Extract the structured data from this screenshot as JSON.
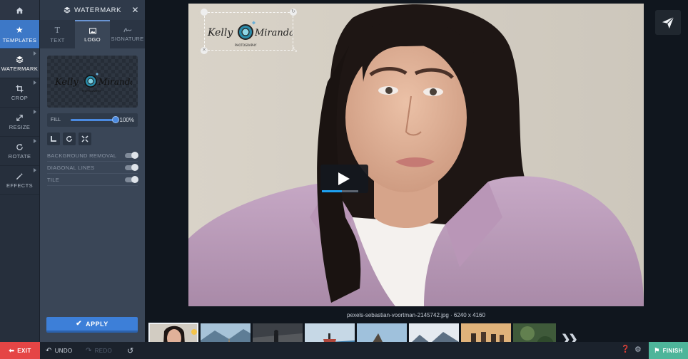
{
  "leftnav": {
    "items": [
      {
        "label": "TEMPLATES",
        "icon": "star-icon"
      },
      {
        "label": "WATERMARK",
        "icon": "layers-icon"
      },
      {
        "label": "CROP",
        "icon": "crop-icon"
      },
      {
        "label": "RESIZE",
        "icon": "resize-icon"
      },
      {
        "label": "ROTATE",
        "icon": "rotate-icon"
      },
      {
        "label": "EFFECTS",
        "icon": "magic-wand-icon"
      }
    ]
  },
  "panel": {
    "title": "WATERMARK",
    "tabs": [
      {
        "label": "TEXT"
      },
      {
        "label": "LOGO"
      },
      {
        "label": "SIGNATURE"
      }
    ],
    "logo_preview": {
      "line1a": "Kelly",
      "line1b": "Miranda",
      "line2": "PHOTOGRAPHY"
    },
    "fill": {
      "label": "FILL",
      "value_text": "100%",
      "value": 100
    },
    "options": [
      {
        "label": "BACKGROUND REMOVAL"
      },
      {
        "label": "DIAGONAL LINES"
      },
      {
        "label": "TILE"
      }
    ],
    "apply_label": "APPLY"
  },
  "watermark": {
    "name1": "Kelly",
    "name2": "Miranda",
    "sub": "PHOTOGRAPHY"
  },
  "image": {
    "caption": "pexels-sebastian-voortman-2145742.jpg · 6240 x 4160",
    "video_progress": 0.55
  },
  "bottombar": {
    "exit_label": "EXIT",
    "undo_label": "UNDO",
    "redo_label": "REDO",
    "finish_label": "FINISH"
  },
  "colors": {
    "accent": "#3d78c7",
    "exit": "#e54545",
    "finish": "#4db59a"
  }
}
